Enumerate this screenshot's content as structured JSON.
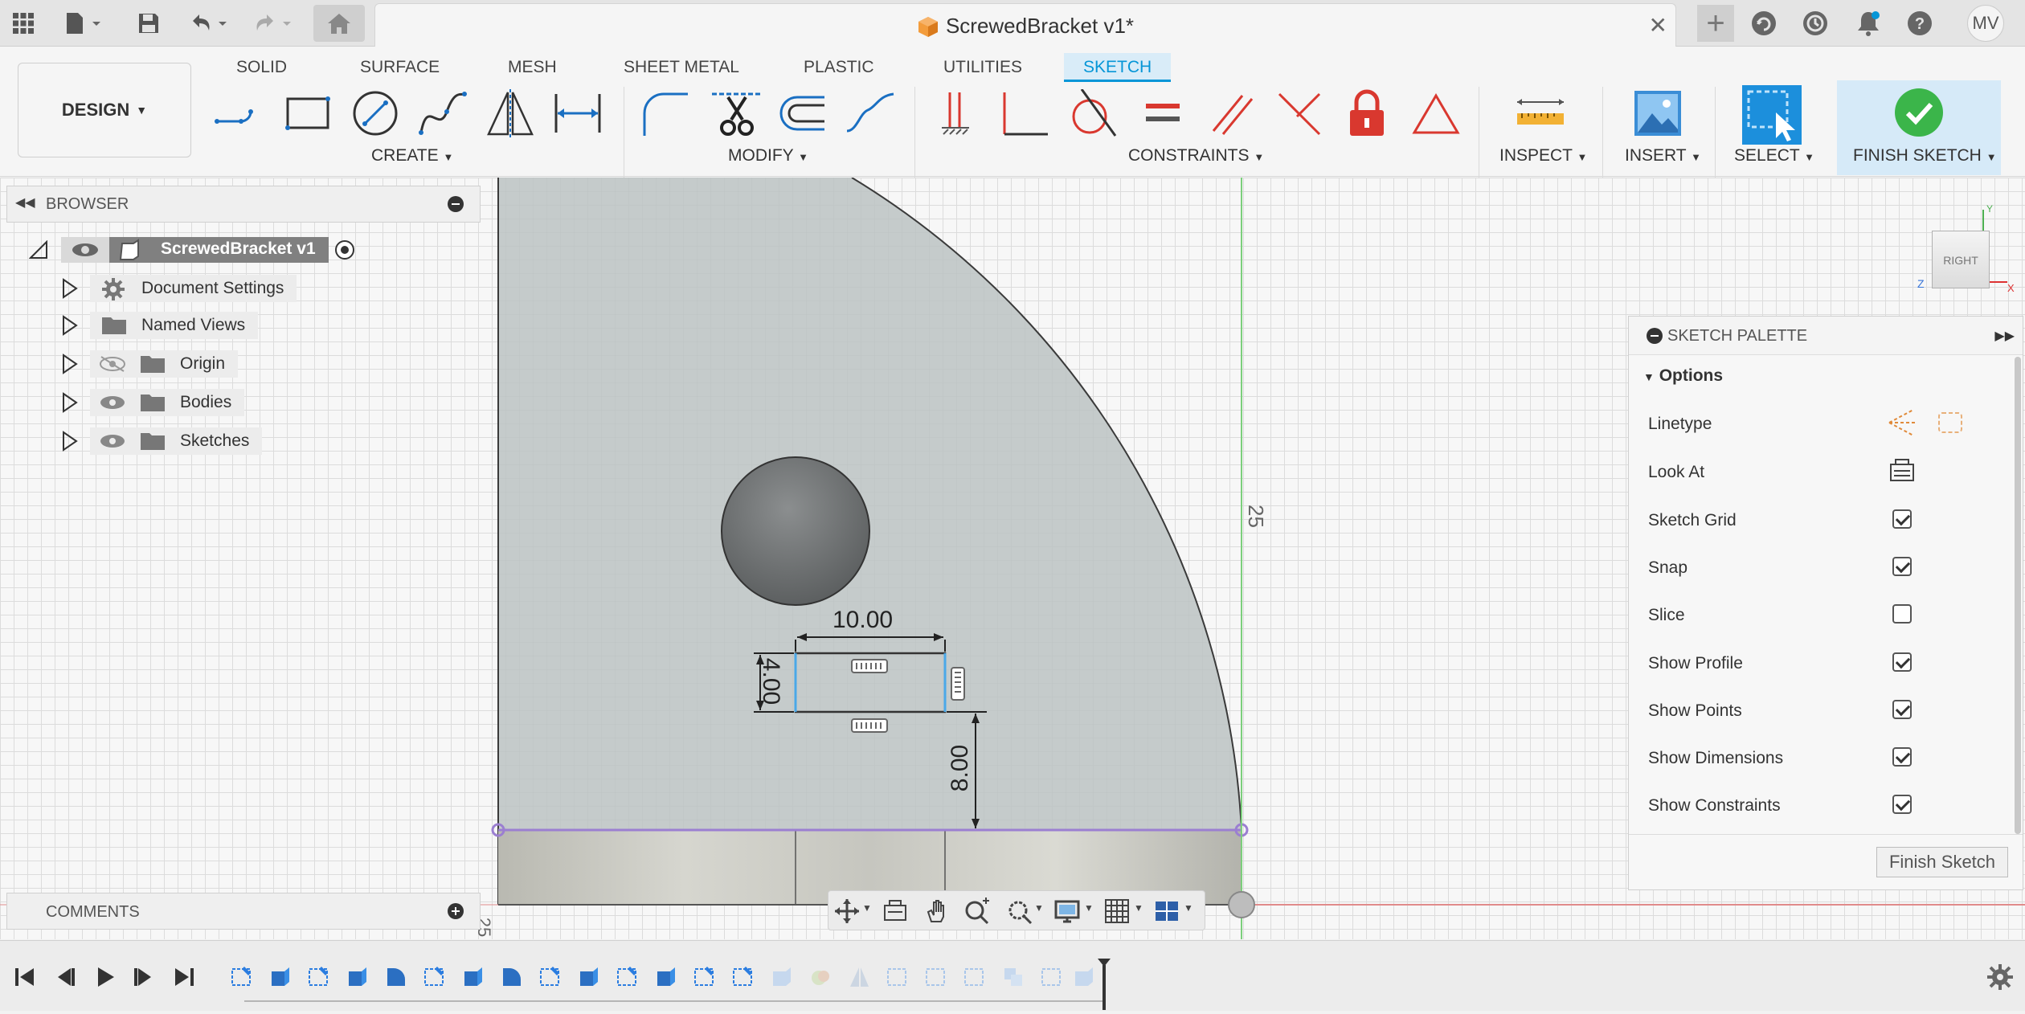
{
  "titlebar": {
    "document_title": "ScrewedBracket v1*",
    "user_initials": "MV",
    "close_glyph": "✕",
    "new_tab_glyph": "+"
  },
  "toolbar": {
    "workspace": "DESIGN",
    "tabs": [
      "SOLID",
      "SURFACE",
      "MESH",
      "SHEET METAL",
      "PLASTIC",
      "UTILITIES",
      "SKETCH"
    ],
    "active_tab": "SKETCH",
    "groups": {
      "create": "CREATE",
      "modify": "MODIFY",
      "constraints": "CONSTRAINTS",
      "inspect": "INSPECT",
      "insert": "INSERT",
      "select": "SELECT",
      "finish": "FINISH SKETCH"
    }
  },
  "browser": {
    "title": "BROWSER",
    "root": "ScrewedBracket v1",
    "items": [
      "Document Settings",
      "Named Views",
      "Origin",
      "Bodies",
      "Sketches"
    ]
  },
  "comments": {
    "title": "COMMENTS"
  },
  "viewcube": {
    "face": "RIGHT",
    "axis_z": "Z",
    "axis_x": "X",
    "axis_y": "Y"
  },
  "sketch": {
    "dim_width": "10.00",
    "dim_height": "4.00",
    "dim_offset": "8.00",
    "axis_label": "25",
    "ruler_label_left": "25"
  },
  "palette": {
    "title": "SKETCH PALETTE",
    "section": "Options",
    "rows": [
      {
        "label": "Linetype"
      },
      {
        "label": "Look At"
      },
      {
        "label": "Sketch Grid",
        "checked": true
      },
      {
        "label": "Snap",
        "checked": true
      },
      {
        "label": "Slice",
        "checked": false
      },
      {
        "label": "Show Profile",
        "checked": true
      },
      {
        "label": "Show Points",
        "checked": true
      },
      {
        "label": "Show Dimensions",
        "checked": true
      },
      {
        "label": "Show Constraints",
        "checked": true
      }
    ],
    "finish_button": "Finish Sketch"
  },
  "colors": {
    "accent": "#0696d7",
    "finish_green": "#3bb54a",
    "constraint_red": "#d9382f",
    "body_fill": "#c8cdcd"
  }
}
